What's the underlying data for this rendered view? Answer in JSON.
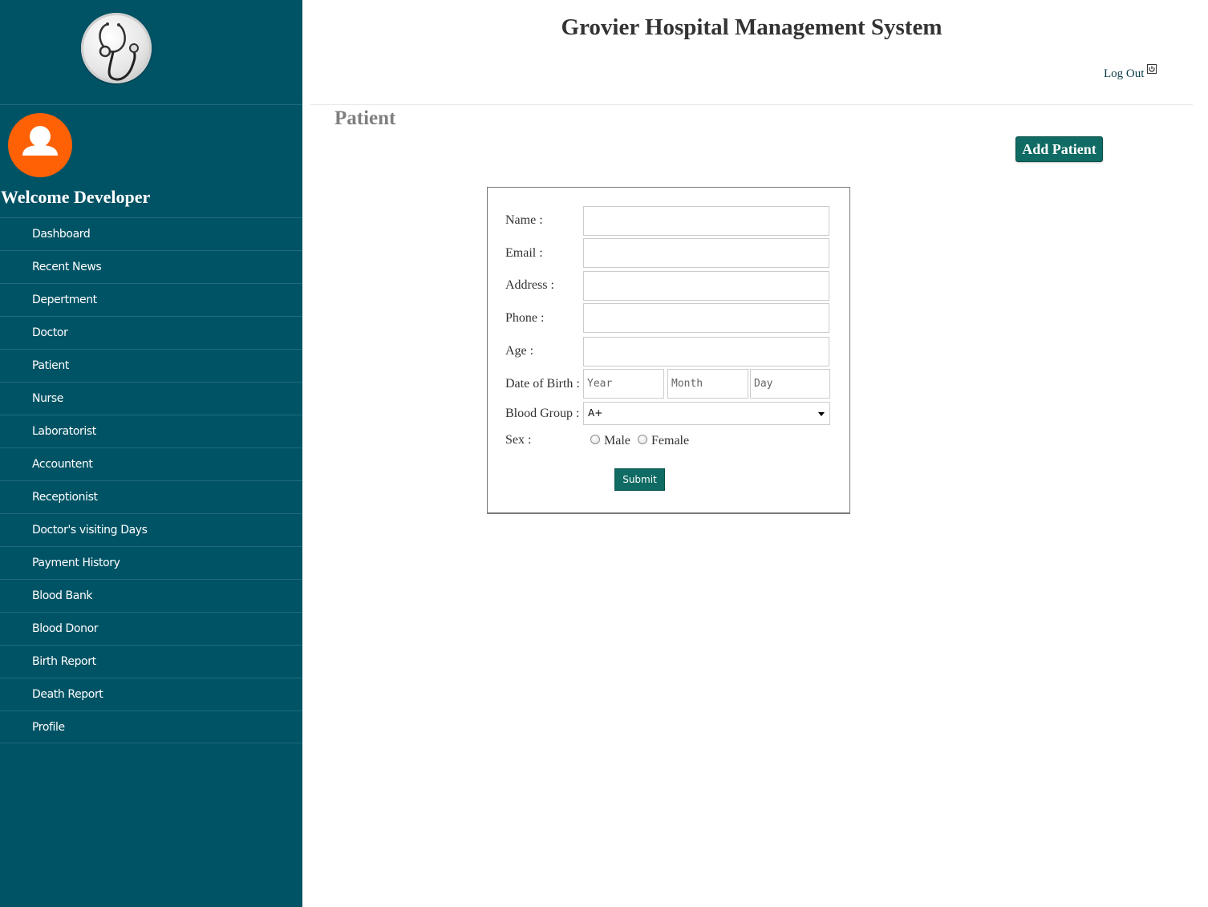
{
  "app": {
    "title": "Grovier Hospital Management System",
    "logout_label": "Log Out"
  },
  "sidebar": {
    "welcome": "Welcome Developer",
    "items": [
      {
        "label": "Dashboard"
      },
      {
        "label": "Recent News"
      },
      {
        "label": "Depertment"
      },
      {
        "label": "Doctor"
      },
      {
        "label": "Patient"
      },
      {
        "label": "Nurse"
      },
      {
        "label": "Laboratorist"
      },
      {
        "label": "Accountent"
      },
      {
        "label": "Receptionist"
      },
      {
        "label": "Doctor's visiting Days"
      },
      {
        "label": "Payment History"
      },
      {
        "label": "Blood Bank"
      },
      {
        "label": "Blood Donor"
      },
      {
        "label": "Birth Report"
      },
      {
        "label": "Death Report"
      },
      {
        "label": "Profile"
      }
    ]
  },
  "page": {
    "title": "Patient",
    "add_button_label": "Add Patient"
  },
  "form": {
    "name_label": "Name :",
    "name_value": "",
    "email_label": "Email :",
    "email_value": "",
    "address_label": "Address :",
    "address_value": "",
    "phone_label": "Phone :",
    "phone_value": "",
    "age_label": "Age :",
    "age_value": "",
    "dob_label": "Date of Birth :",
    "dob_year_placeholder": "Year",
    "dob_month_placeholder": "Month",
    "dob_day_placeholder": "Day",
    "blood_group_label": "Blood Group :",
    "blood_group_value": "A+",
    "sex_label": "Sex :",
    "sex_options": [
      "Male",
      "Female"
    ],
    "submit_label": "Submit"
  },
  "colors": {
    "sidebar_bg": "#005365",
    "accent_button": "#0f6b63",
    "avatar_bg": "#ff6104"
  },
  "icons": {
    "logo": "stethoscope-icon",
    "avatar": "user-icon",
    "logout": "power-icon",
    "select": "chevron-down-icon"
  }
}
